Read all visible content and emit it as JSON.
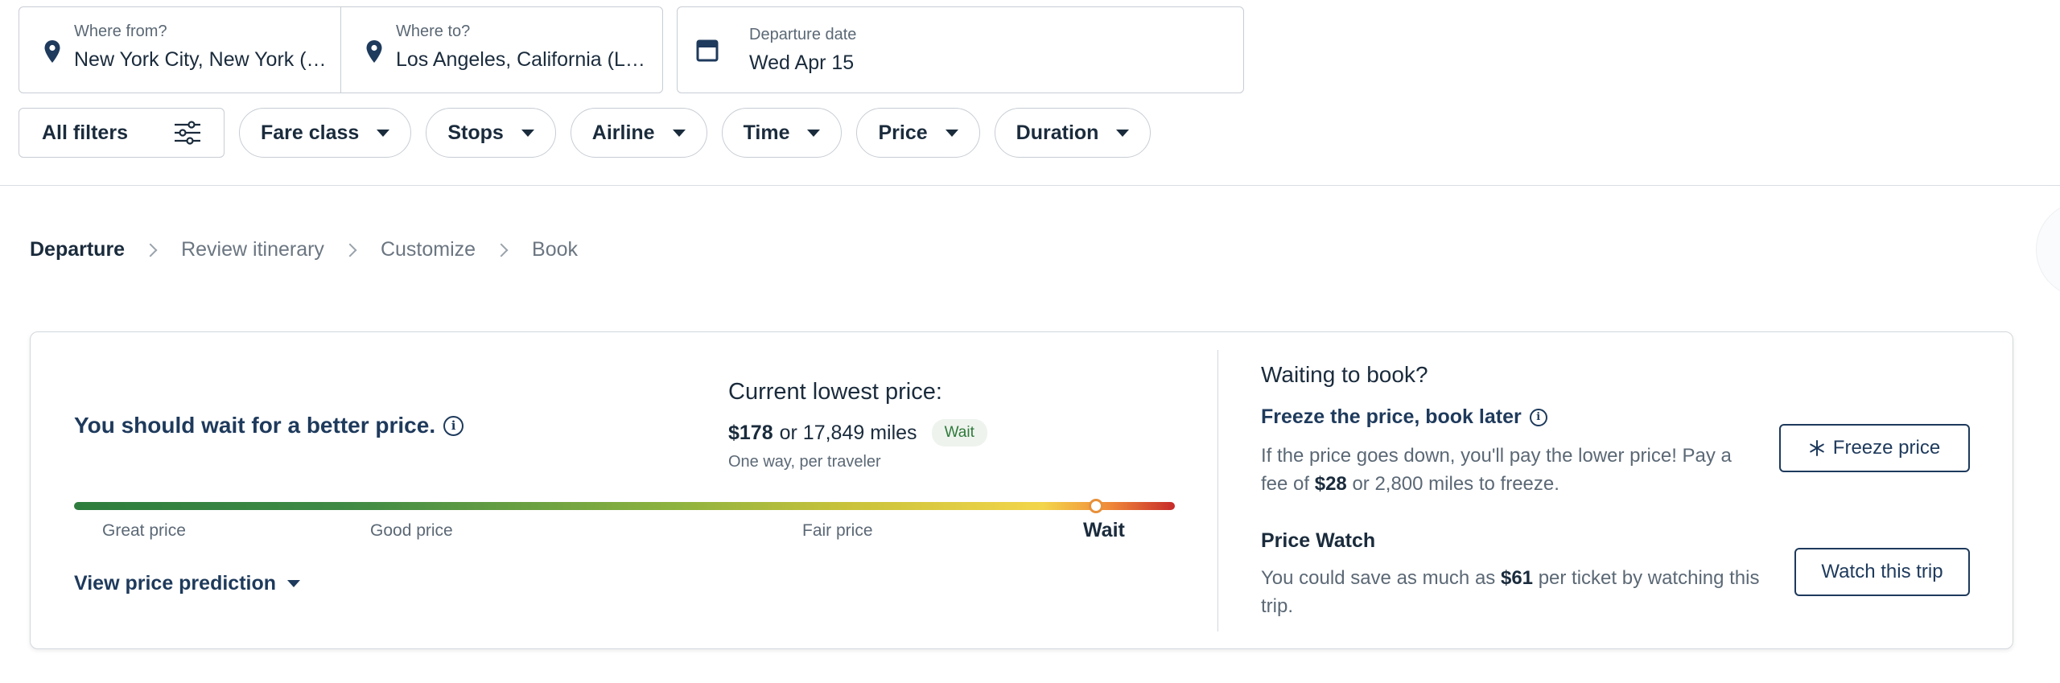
{
  "search": {
    "from_label": "Where from?",
    "from_value": "New York City, New York (JFK)",
    "to_label": "Where to?",
    "to_value": "Los Angeles, California (LAX)",
    "date_label": "Departure date",
    "date_value": "Wed Apr 15"
  },
  "filters": {
    "all": "All filters",
    "chips": [
      "Fare class",
      "Stops",
      "Airline",
      "Time",
      "Price",
      "Duration"
    ]
  },
  "breadcrumb": [
    "Departure",
    "Review itinerary",
    "Customize",
    "Book"
  ],
  "prediction": {
    "title": "You should wait for a better price.",
    "current_label": "Current lowest price:",
    "price": "$178",
    "miles_text": "or 17,849 miles",
    "badge": "Wait",
    "per_traveler": "One way, per traveler",
    "scale_labels": [
      "Great price",
      "Good price",
      "Fair price",
      "Wait"
    ],
    "view_link": "View price prediction"
  },
  "booking": {
    "waiting_title": "Waiting to book?",
    "freeze_title": "Freeze the price, book later",
    "freeze_desc_1": "If the price goes down, you'll pay the lower price! Pay a fee of",
    "freeze_fee": "$28",
    "freeze_desc_2": "or 2,800 miles to freeze.",
    "freeze_button": "Freeze price",
    "watch_title": "Price Watch",
    "watch_desc_1": "You could save as much as",
    "watch_amount": "$61",
    "watch_desc_2": "per ticket by watching this trip.",
    "watch_button": "Watch this trip"
  },
  "colors": {
    "primary": "#1e3a5c",
    "badge_bg": "#eef3ee",
    "badge_text": "#2f7a3a",
    "marker": "#e8903a"
  },
  "icons": [
    "location-pin-icon",
    "calendar-icon",
    "sliders-icon",
    "chevron-right-icon",
    "info-icon",
    "snowflake-icon",
    "caret-down-icon"
  ]
}
